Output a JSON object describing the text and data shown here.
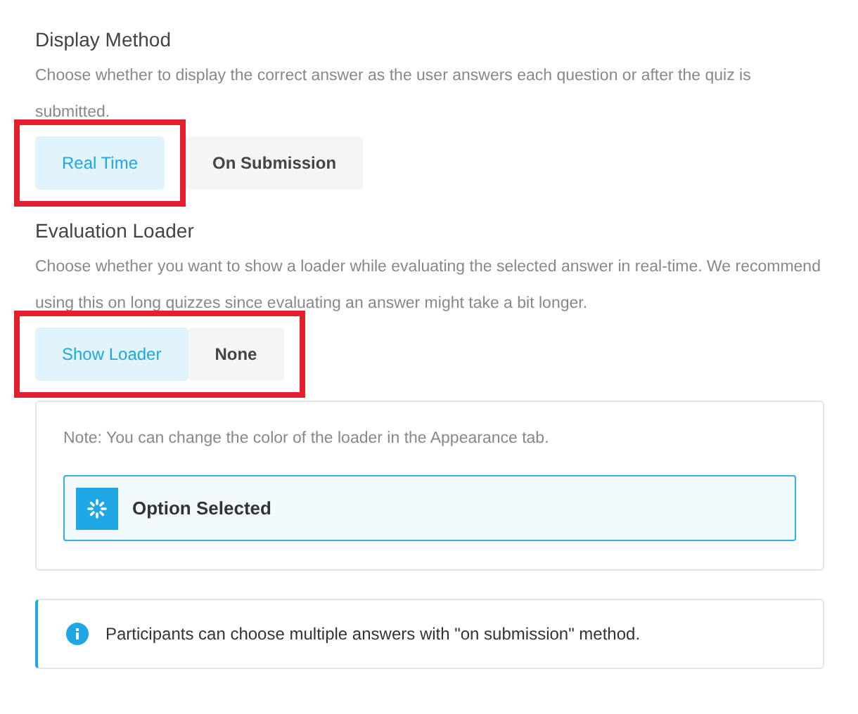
{
  "sections": [
    {
      "title": "Display Method",
      "description": "Choose whether to display the correct answer as the user answers each question or after the quiz is submitted.",
      "options": [
        {
          "label": "Real Time",
          "selected": true,
          "highlighted": true
        },
        {
          "label": "On Submission",
          "selected": false,
          "highlighted": false
        }
      ]
    },
    {
      "title": "Evaluation Loader",
      "description": "Choose whether you want to show a loader while evaluating the selected answer in real-time. We recommend using this on long quizzes since evaluating an answer might take a bit longer.",
      "options": [
        {
          "label": "Show Loader",
          "selected": true,
          "highlighted": true
        },
        {
          "label": "None",
          "selected": false,
          "highlighted": true
        }
      ],
      "panel": {
        "note": "Note: You can change the color of the loader in the Appearance tab.",
        "preview": "Option Selected"
      }
    }
  ],
  "info": "Participants can choose multiple answers with \"on submission\" method."
}
